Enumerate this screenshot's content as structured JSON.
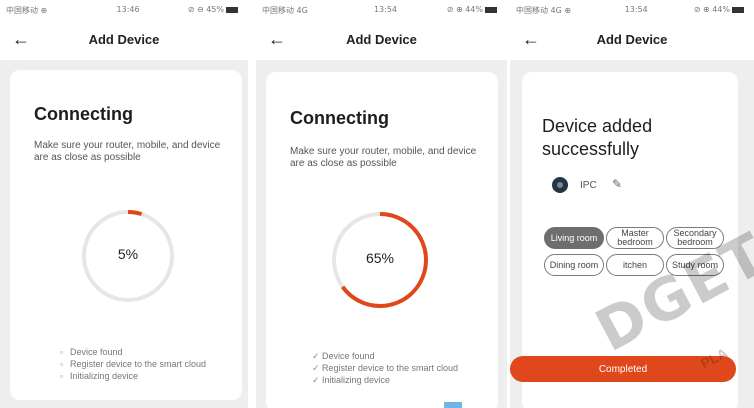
{
  "accent_color": "#e0481c",
  "screens": [
    {
      "status": {
        "left": "中国移动 ⊕",
        "time": "13:46",
        "right": "⊘ ⊖ 45%"
      },
      "title": "Add Device",
      "heading": "Connecting",
      "subtitle": "Make sure your router, mobile, and device are as close as possible",
      "progress": "5%",
      "progress_value": 5,
      "steps": [
        {
          "mark": "▫",
          "label": "Device found"
        },
        {
          "mark": "▫",
          "label": "Register device to the smart cloud"
        },
        {
          "mark": "▫",
          "label": "Initializing device"
        }
      ]
    },
    {
      "status": {
        "left": "中国移动 4G",
        "time": "13:54",
        "right": "⊘ ⊕ 44%"
      },
      "title": "Add Device",
      "heading": "Connecting",
      "subtitle": "Make sure your router, mobile, and device are as close as possible",
      "progress": "65%",
      "progress_value": 65,
      "steps": [
        {
          "mark": "✓",
          "label": "Device found"
        },
        {
          "mark": "✓",
          "label": "Register device to the smart cloud"
        },
        {
          "mark": "✓",
          "label": "Initializing device"
        }
      ]
    },
    {
      "status": {
        "left": "中国移动 4G ⊕",
        "time": "13:54",
        "right": "⊘ ⊕ 44%"
      },
      "title": "Add Device",
      "heading": "Device added successfully",
      "device_name": "IPC",
      "rooms": [
        {
          "label": "Living room",
          "selected": true
        },
        {
          "label": "Master bedroom",
          "selected": false
        },
        {
          "label": "Secondary bedroom",
          "selected": false
        },
        {
          "label": "Dining room",
          "selected": false
        },
        {
          "label": "itchen",
          "selected": false
        },
        {
          "label": "Study room",
          "selected": false
        }
      ],
      "button": "Completed"
    }
  ],
  "watermark": {
    "main": "DGET",
    "sub": "PLA"
  }
}
